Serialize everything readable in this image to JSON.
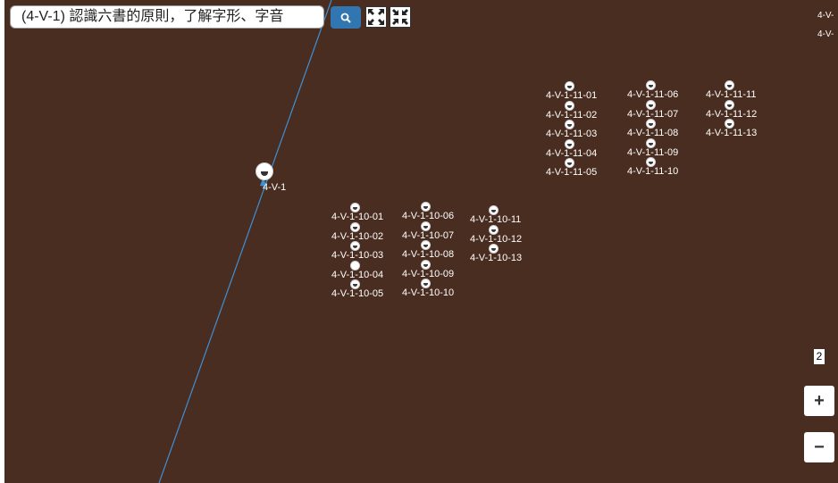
{
  "header": {
    "title": "(4-V-1) 認識六書的原則，了解字形、字音",
    "search_icon": "search-icon",
    "expand_icon": "expand-icon",
    "collapse_icon": "collapse-icon"
  },
  "graph": {
    "root": "4-V-1",
    "group10": [
      "4-V-1-10-01",
      "4-V-1-10-02",
      "4-V-1-10-03",
      "4-V-1-10-04",
      "4-V-1-10-05",
      "4-V-1-10-06",
      "4-V-1-10-07",
      "4-V-1-10-08",
      "4-V-1-10-09",
      "4-V-1-10-10",
      "4-V-1-10-11",
      "4-V-1-10-12",
      "4-V-1-10-13"
    ],
    "group11": [
      "4-V-1-11-01",
      "4-V-1-11-02",
      "4-V-1-11-03",
      "4-V-1-11-04",
      "4-V-1-11-05",
      "4-V-1-11-06",
      "4-V-1-11-07",
      "4-V-1-11-08",
      "4-V-1-11-09",
      "4-V-1-11-10",
      "4-V-1-11-11",
      "4-V-1-11-12",
      "4-V-1-11-13"
    ],
    "edge_labels": [
      "4-V-",
      "4-V-"
    ],
    "colors": {
      "background": "#4a2d21",
      "link": "#3d8fd6",
      "node": "#ffffff"
    }
  },
  "controls": {
    "level": "2",
    "zoom_in": "+",
    "zoom_out": "−"
  }
}
